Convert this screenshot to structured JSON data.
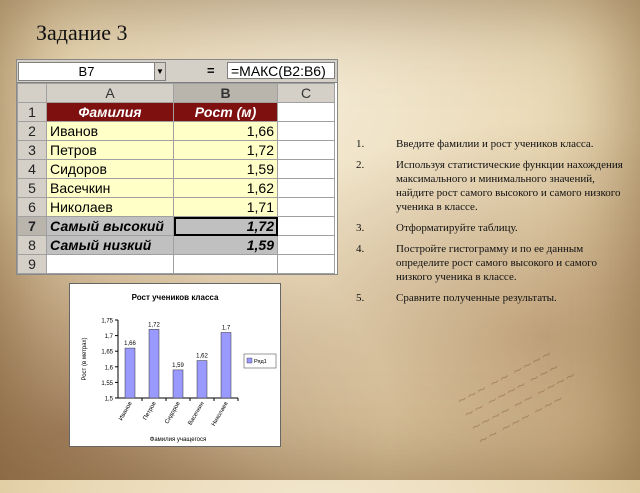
{
  "title": "Задание 3",
  "formula_bar": {
    "name_box": "B7",
    "equals": "=",
    "formula": "=МАКС(B2:B6)"
  },
  "sheet": {
    "columns": [
      "A",
      "B",
      "C"
    ],
    "rows": [
      "1",
      "2",
      "3",
      "4",
      "5",
      "6",
      "7",
      "8",
      "9"
    ],
    "header": {
      "name": "Фамилия",
      "height": "Рост (м)"
    },
    "students": [
      {
        "name": "Иванов",
        "height": "1,66"
      },
      {
        "name": "Петров",
        "height": "1,72"
      },
      {
        "name": "Сидоров",
        "height": "1,59"
      },
      {
        "name": "Васечкин",
        "height": "1,62"
      },
      {
        "name": "Николаев",
        "height": "1,71"
      }
    ],
    "max_row": {
      "label": "Самый высокий",
      "value": "1,72"
    },
    "min_row": {
      "label": "Самый низкий",
      "value": "1,59"
    }
  },
  "chart_data": {
    "type": "bar",
    "title": "Рост учеников класса",
    "xlabel": "Фамилия учащегося",
    "ylabel": "Рост (в метрах)",
    "categories": [
      "Иванов",
      "Петров",
      "Сидоров",
      "Васечкин",
      "Николаев"
    ],
    "series": [
      {
        "name": "Ряд1",
        "values": [
          1.66,
          1.72,
          1.59,
          1.62,
          1.71
        ],
        "labels": [
          "1,66",
          "1,72",
          "1,59",
          "1,62",
          "1,7"
        ]
      }
    ],
    "ylim": [
      1.5,
      1.75
    ],
    "yticks": [
      "1,75",
      "1,7",
      "1,65",
      "1,6",
      "1,55",
      "1,5"
    ],
    "bar_color": "#9999ff",
    "grid": false,
    "legend": "right"
  },
  "tasks": [
    {
      "num": "1.",
      "text": "Введите фамилии и рост учеников класса."
    },
    {
      "num": "2.",
      "text": "Используя статистические функции нахождения максимального и минимального значений, найдите рост самого высокого и самого низкого ученика в классе."
    },
    {
      "num": "3.",
      "text": "Отформатируйте таблицу."
    },
    {
      "num": "4.",
      "text": "Постройте гистограмму и по ее данным определите рост самого высокого и самого низкого ученика в классе."
    },
    {
      "num": "5.",
      "text": "Сравните полученные результаты."
    }
  ]
}
